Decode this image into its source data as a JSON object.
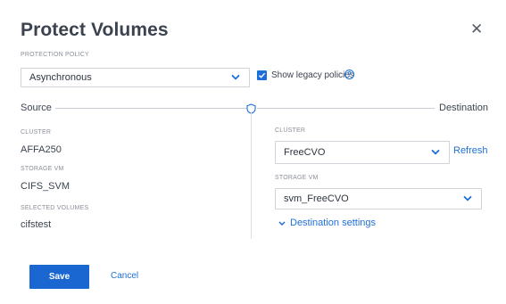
{
  "dialog": {
    "title": "Protect Volumes"
  },
  "policy": {
    "caption": "PROTECTION POLICY",
    "selected": "Asynchronous"
  },
  "legacy": {
    "label": "Show legacy policies",
    "checked": true
  },
  "source": {
    "label": "Source",
    "cluster_caption": "CLUSTER",
    "cluster_value": "AFFA250",
    "svm_caption": "STORAGE VM",
    "svm_value": "CIFS_SVM",
    "volumes_caption": "SELECTED VOLUMES",
    "volumes_value": "cifstest"
  },
  "destination": {
    "label": "Destination",
    "cluster_caption": "CLUSTER",
    "cluster_selected": "FreeCVO",
    "refresh_label": "Refresh",
    "svm_caption": "STORAGE VM",
    "svm_selected": "svm_FreeCVO",
    "settings_label": "Destination settings"
  },
  "actions": {
    "save_label": "Save",
    "cancel_label": "Cancel"
  },
  "colors": {
    "accent": "#1f6fd8",
    "primary_button": "#1a67d2"
  }
}
